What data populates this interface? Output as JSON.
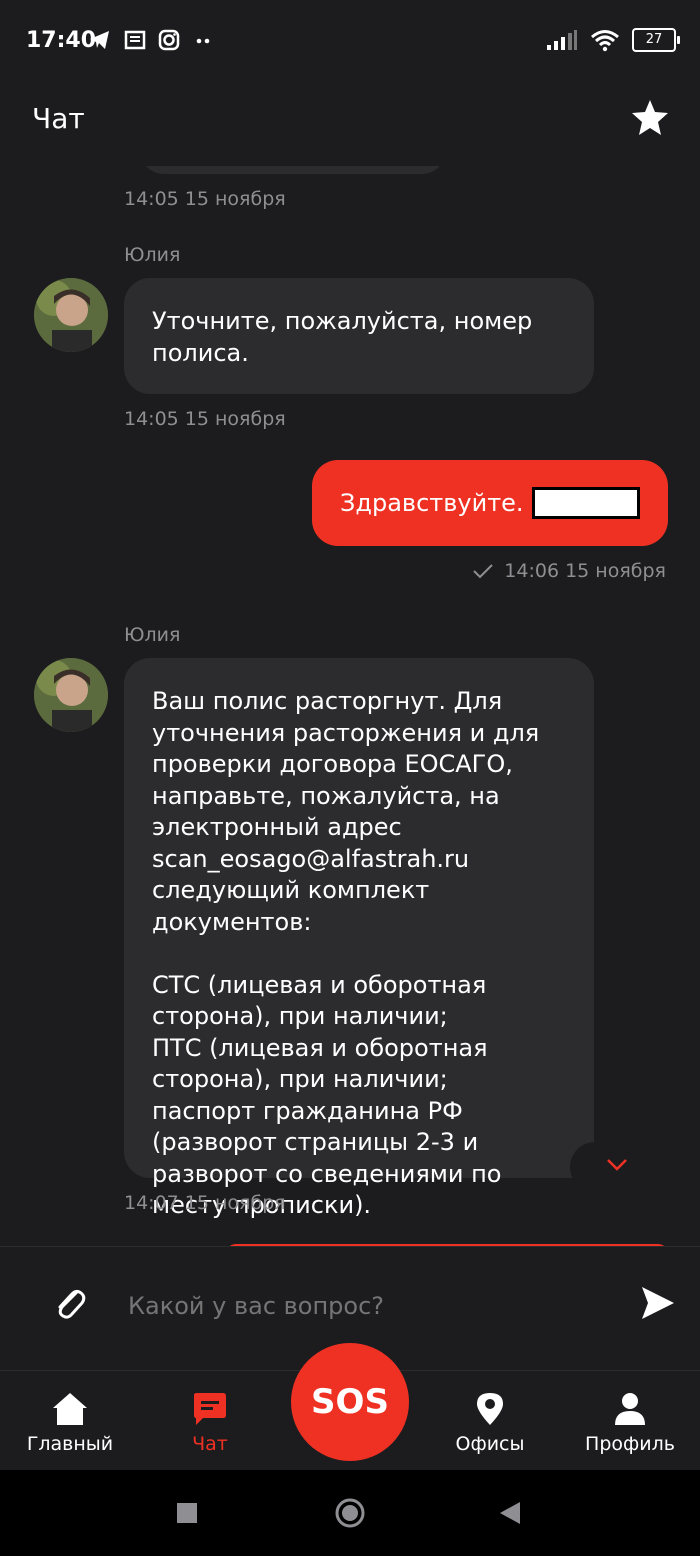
{
  "status_bar": {
    "time": "17:40",
    "battery": "27"
  },
  "header": {
    "title": "Чат"
  },
  "messages": [
    {
      "type": "timestamp",
      "text": "14:05 15 ноября"
    },
    {
      "type": "incoming",
      "sender": "Юлия",
      "text": "Уточните, пожалуйста, номер полиса.",
      "time": "14:05 15 ноября"
    },
    {
      "type": "outgoing",
      "text": "Здравствуйте.",
      "time": "14:06 15 ноября"
    },
    {
      "type": "incoming",
      "sender": "Юлия",
      "text": "Ваш полис расторгнут. Для уточнения расторжения и для проверки договора ЕОСАГО, направьте, пожалуйста, на электронный адрес scan_eosago@alfastrah.ru следующий комплект документов:\n\nСТС (лицевая и оборотная сторона), при наличии;\nПТС (лицевая и оборотная сторона), при наличии;\nпаспорт гражданина РФ (разворот страницы 2-3 и разворот со сведениями по месту прописки).",
      "time": "14:07 15 ноября"
    }
  ],
  "input": {
    "placeholder": "Какой у вас вопрос?"
  },
  "nav": {
    "home": "Главный",
    "chat": "Чат",
    "sos": "SOS",
    "offices": "Офисы",
    "profile": "Профиль"
  },
  "colors": {
    "accent": "#ef3124",
    "background": "#1c1c1e",
    "bubble": "#2c2c2e",
    "muted": "#8e8e93"
  }
}
